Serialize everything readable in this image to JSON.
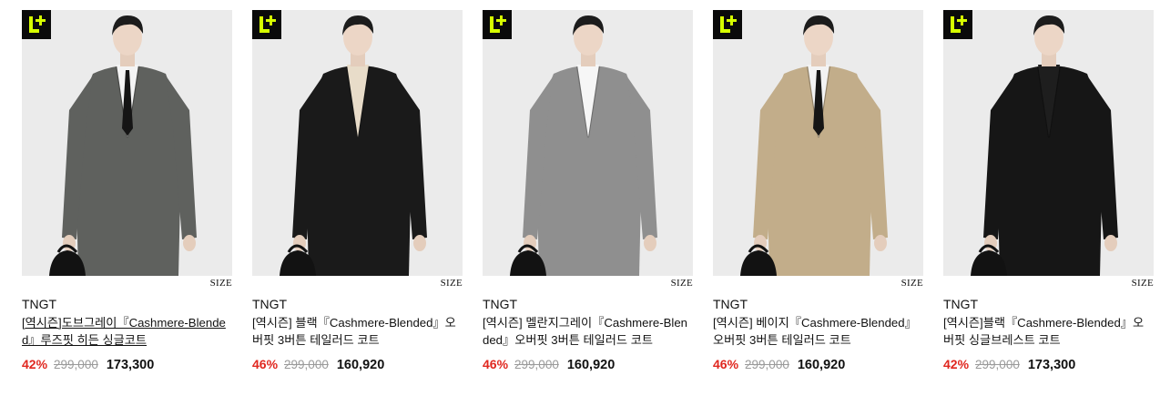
{
  "badge_icon": "l-plus-icon",
  "accent_color": "#e0271f",
  "badge_color": "#d6ff00",
  "products": [
    {
      "size_label": "SIZE",
      "brand": "TNGT",
      "name": "[역시즌]도브그레이『Cashmere-Blended』루즈핏 히든 싱글코트",
      "discount": "42%",
      "original_price": "299,000",
      "sale_price": "173,300",
      "coat_color": "#5f615e",
      "inner_color": "#f4f4f4",
      "tie": true,
      "pants_color": "#2a2a2a"
    },
    {
      "size_label": "SIZE",
      "brand": "TNGT",
      "name": "[역시즌] 블랙『Cashmere-Blended』오버핏 3버튼 테일러드 코트",
      "discount": "46%",
      "original_price": "299,000",
      "sale_price": "160,920",
      "coat_color": "#1a1a1a",
      "inner_color": "#e8dcc9",
      "tie": false,
      "pants_color": "#4d4d4d"
    },
    {
      "size_label": "SIZE",
      "brand": "TNGT",
      "name": "[역시즌] 멜란지그레이『Cashmere-Blended』오버핏 3버튼 테일러드 코트",
      "discount": "46%",
      "original_price": "299,000",
      "sale_price": "160,920",
      "coat_color": "#8f8f8f",
      "inner_color": "#f6f6f6",
      "tie": false,
      "pants_color": "#d9d2c3"
    },
    {
      "size_label": "SIZE",
      "brand": "TNGT",
      "name": "[역시즌] 베이지『Cashmere-Blended』오버핏 3버튼 테일러드 코트",
      "discount": "46%",
      "original_price": "299,000",
      "sale_price": "160,920",
      "coat_color": "#c2ad8a",
      "inner_color": "#f3f3f3",
      "tie": true,
      "pants_color": "#2a2a2a"
    },
    {
      "size_label": "SIZE",
      "brand": "TNGT",
      "name": "[역시즌]블랙『Cashmere-Blended』오버핏 싱글브레스트 코트",
      "discount": "42%",
      "original_price": "299,000",
      "sale_price": "173,300",
      "coat_color": "#161616",
      "inner_color": "#1e1e1e",
      "tie": false,
      "pants_color": "#8fa7c2"
    }
  ]
}
